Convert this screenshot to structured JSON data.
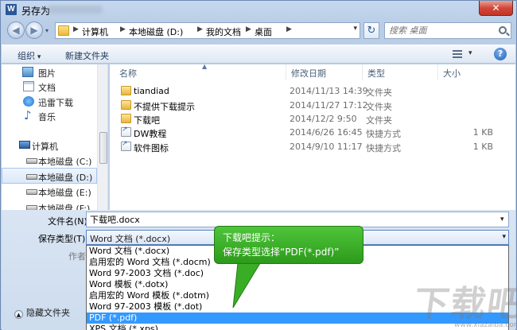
{
  "window": {
    "title": "另存为",
    "app_icon": "W"
  },
  "titlebar": {
    "close_glyph": "✕"
  },
  "nav": {
    "back_glyph": "◀",
    "forward_glyph": "▶",
    "breadcrumb": [
      "计算机",
      "本地磁盘 (D:)",
      "我的文档",
      "桌面"
    ],
    "separator": "▶",
    "dropdown_glyph": "▾",
    "refresh_glyph": "↻",
    "search_placeholder": "搜索 桌面"
  },
  "toolbar": {
    "organize_label": "组织",
    "new_folder_label": "新建文件夹",
    "view_dd_glyph": "▾",
    "help_glyph": "?"
  },
  "sidebar": {
    "items": [
      {
        "label": "图片",
        "icon": "picture-icon"
      },
      {
        "label": "文档",
        "icon": "document-icon"
      },
      {
        "label": "迅雷下载",
        "icon": "thunder-icon"
      },
      {
        "label": "音乐",
        "icon": "music-icon"
      },
      {
        "label": "计算机",
        "icon": "computer-icon"
      },
      {
        "label": "本地磁盘 (C:)",
        "icon": "drive-icon"
      },
      {
        "label": "本地磁盘 (D:)",
        "icon": "drive-icon"
      },
      {
        "label": "本地磁盘 (E:)",
        "icon": "drive-icon"
      },
      {
        "label": "本地磁盘 (F:)",
        "icon": "drive-icon"
      }
    ]
  },
  "file_list": {
    "columns": {
      "name": "名称",
      "date": "修改日期",
      "type": "类型",
      "size": "大小"
    },
    "sort_glyph": "▲",
    "rows": [
      {
        "name": "tiandiad",
        "date": "2014/11/13 14:39",
        "type": "文件夹",
        "size": "",
        "icon": "folder-icon"
      },
      {
        "name": "不提供下载提示",
        "date": "2014/11/27 17:12",
        "type": "文件夹",
        "size": "",
        "icon": "folder-icon"
      },
      {
        "name": "下载吧",
        "date": "2014/12/2 9:50",
        "type": "文件夹",
        "size": "",
        "icon": "folder-icon"
      },
      {
        "name": "DW教程",
        "date": "2014/6/26 16:45",
        "type": "快捷方式",
        "size": "1 KB",
        "icon": "shortcut-icon"
      },
      {
        "name": "软件图标",
        "date": "2014/9/10 11:17",
        "type": "快捷方式",
        "size": "1 KB",
        "icon": "shortcut-icon"
      }
    ]
  },
  "form": {
    "filename_label": "文件名(N):",
    "filename_value": "下载吧.docx",
    "savetype_label": "保存类型(T):",
    "savetype_value": "Word 文档 (*.docx)",
    "author_label": "作者:",
    "hide_folders_label": "隐藏文件夹",
    "dd_glyph": "▾",
    "up_glyph": "▲"
  },
  "type_options": [
    "Word 文档 (*.docx)",
    "启用宏的 Word 文档 (*.docm)",
    "Word 97-2003 文档 (*.doc)",
    "Word 模板 (*.dotx)",
    "启用宏的 Word 模板 (*.dotm)",
    "Word 97-2003 模板 (*.dot)",
    "PDF (*.pdf)",
    "XPS 文档 (*.xps)"
  ],
  "highlighted_option_index": 6,
  "callout": {
    "line1": "下载吧提示：",
    "line2": "保存类型选择“PDF(*.pdf)”",
    "color": "#3aad27"
  },
  "watermark": {
    "text": "下载吧",
    "sub": "www.xiazaiba.com"
  },
  "colors": {
    "selection": "#3399ff",
    "close_button": "#c23526"
  }
}
